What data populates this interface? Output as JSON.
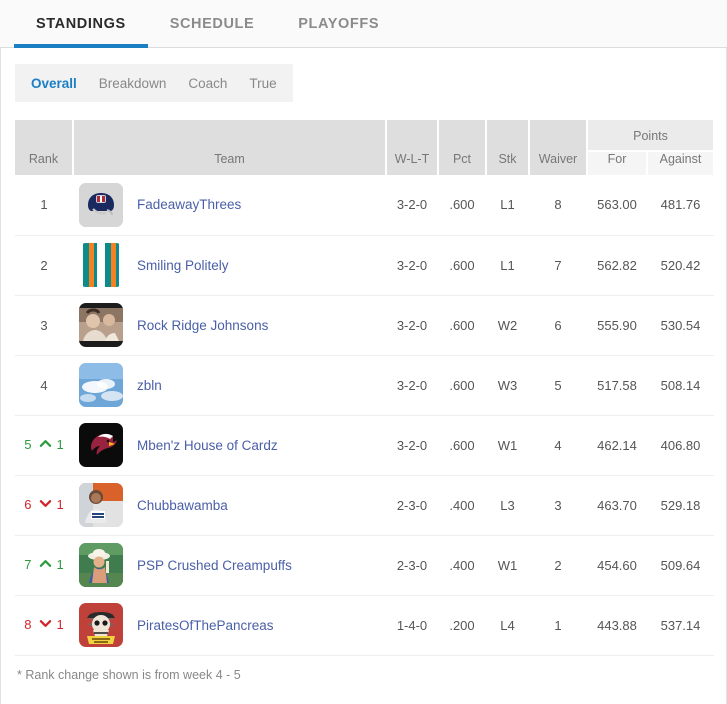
{
  "tabs": [
    {
      "label": "STANDINGS",
      "active": true
    },
    {
      "label": "SCHEDULE",
      "active": false
    },
    {
      "label": "PLAYOFFS",
      "active": false
    }
  ],
  "subtabs": [
    {
      "label": "Overall",
      "active": true
    },
    {
      "label": "Breakdown",
      "active": false
    },
    {
      "label": "Coach",
      "active": false
    },
    {
      "label": "True",
      "active": false
    }
  ],
  "table": {
    "group_header": "Points",
    "columns": {
      "rank": "Rank",
      "team": "Team",
      "wlt": "W-L-T",
      "pct": "Pct",
      "stk": "Stk",
      "waiver": "Waiver",
      "points_for": "For",
      "points_against": "Against"
    },
    "rows": [
      {
        "rank": "1",
        "change": "none",
        "delta": "",
        "team": "FadeawayThrees",
        "avatar": "nfl-helmet-icon",
        "wlt": "3-2-0",
        "pct": ".600",
        "stk": "L1",
        "waiver": "8",
        "points_for": "563.00",
        "points_against": "481.76"
      },
      {
        "rank": "2",
        "change": "none",
        "delta": "",
        "team": "Smiling Politely",
        "avatar": "teal-orange-stripes-icon",
        "wlt": "3-2-0",
        "pct": ".600",
        "stk": "L1",
        "waiver": "7",
        "points_for": "562.82",
        "points_against": "520.42"
      },
      {
        "rank": "3",
        "change": "none",
        "delta": "",
        "team": "Rock Ridge Johnsons",
        "avatar": "photo-portrait-icon",
        "wlt": "3-2-0",
        "pct": ".600",
        "stk": "W2",
        "waiver": "6",
        "points_for": "555.90",
        "points_against": "530.54"
      },
      {
        "rank": "4",
        "change": "none",
        "delta": "",
        "team": "zbln",
        "avatar": "sky-clouds-icon",
        "wlt": "3-2-0",
        "pct": ".600",
        "stk": "W3",
        "waiver": "5",
        "points_for": "517.58",
        "points_against": "508.14"
      },
      {
        "rank": "5",
        "change": "up",
        "delta": "1",
        "team": "Mben'z House of Cardz",
        "avatar": "cardinals-logo-icon",
        "wlt": "3-2-0",
        "pct": ".600",
        "stk": "W1",
        "waiver": "4",
        "points_for": "462.14",
        "points_against": "406.80"
      },
      {
        "rank": "6",
        "change": "down",
        "delta": "1",
        "team": "Chubbawamba",
        "avatar": "photo-person-orange-icon",
        "wlt": "2-3-0",
        "pct": ".400",
        "stk": "L3",
        "waiver": "3",
        "points_for": "463.70",
        "points_against": "529.18"
      },
      {
        "rank": "7",
        "change": "up",
        "delta": "1",
        "team": "PSP Crushed Creampuffs",
        "avatar": "photo-beach-hat-icon",
        "wlt": "2-3-0",
        "pct": ".400",
        "stk": "W1",
        "waiver": "2",
        "points_for": "454.60",
        "points_against": "509.64"
      },
      {
        "rank": "8",
        "change": "down",
        "delta": "1",
        "team": "PiratesOfThePancreas",
        "avatar": "pirate-skull-icon",
        "wlt": "1-4-0",
        "pct": ".200",
        "stk": "L4",
        "waiver": "1",
        "points_for": "443.88",
        "points_against": "537.14"
      }
    ]
  },
  "footnote": "* Rank change shown is from week 4 - 5",
  "colors": {
    "accent": "#1b7fc4",
    "link": "#4a5fa8",
    "up": "#2e9b3f",
    "down": "#d0252a"
  }
}
